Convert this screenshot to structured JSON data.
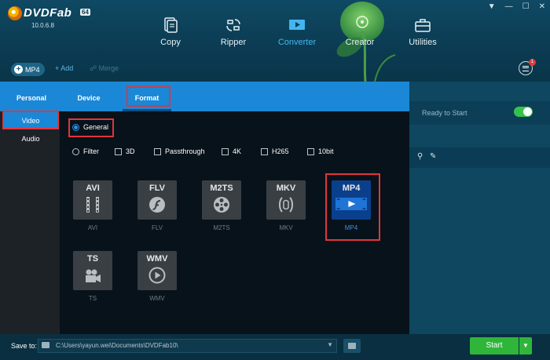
{
  "app": {
    "logo_text": "DVDFab",
    "badge": "64",
    "version": "10.0.6.8"
  },
  "window_controls": [
    "▼",
    "—",
    "☐",
    "✕"
  ],
  "nav": {
    "copy": "Copy",
    "ripper": "Ripper",
    "converter": "Converter",
    "creator": "Creator",
    "utilities": "Utilities"
  },
  "subbar": {
    "profile": "MP4",
    "add": "Add",
    "merge": "Merge",
    "notif_count": "1"
  },
  "right_panel": {
    "status": "Ready to Start"
  },
  "popup": {
    "tabs": {
      "personal": "Personal",
      "device": "Device",
      "format": "Format"
    },
    "left_items": {
      "video": "Video",
      "audio": "Audio"
    },
    "general": "General",
    "filters": {
      "filter": "Filter",
      "d3": "3D",
      "passthrough": "Passthrough",
      "k4": "4K",
      "h265": "H265",
      "bit10": "10bit"
    },
    "formats": [
      {
        "tile": "AVI",
        "label": "AVI"
      },
      {
        "tile": "FLV",
        "label": "FLV"
      },
      {
        "tile": "M2TS",
        "label": "M2TS"
      },
      {
        "tile": "MKV",
        "label": "MKV"
      },
      {
        "tile": "MP4",
        "label": "MP4"
      },
      {
        "tile": "TS",
        "label": "TS"
      },
      {
        "tile": "WMV",
        "label": "WMV"
      }
    ],
    "selected_format": "MP4"
  },
  "bottom": {
    "save_to": "Save to:",
    "path": "C:\\Users\\yayun.wei\\Documents\\DVDFab10\\",
    "start": "Start"
  },
  "colors": {
    "accent": "#1a88d6",
    "highlight": "#e2353d",
    "start": "#2fb63a",
    "active_nav": "#43b6f0"
  }
}
